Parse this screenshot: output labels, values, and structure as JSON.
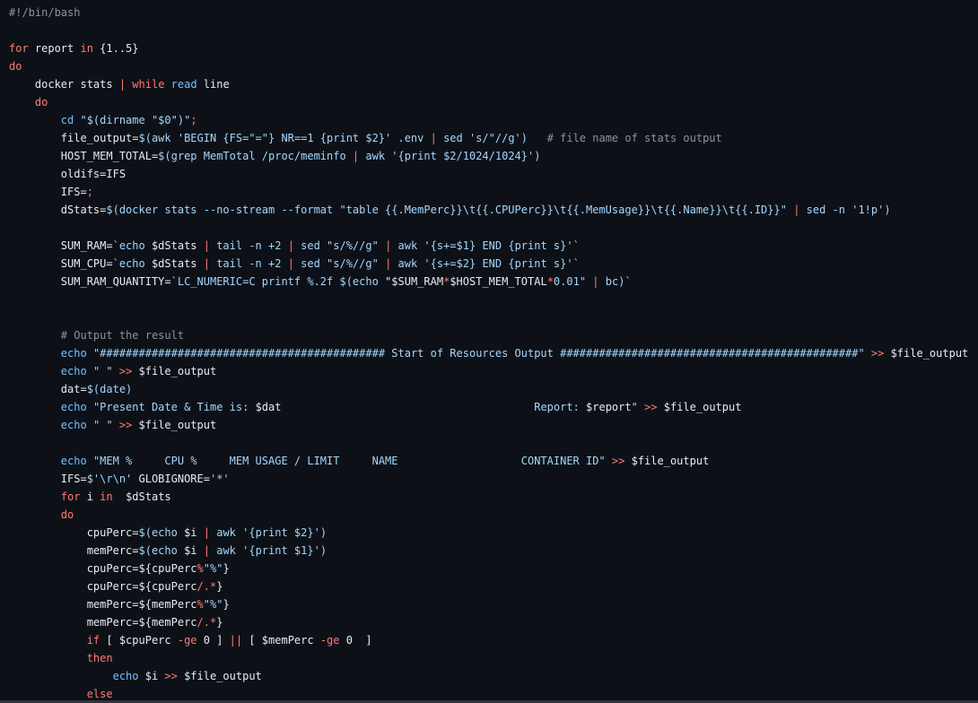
{
  "colors": {
    "background": "#0d1117",
    "default": "#e6edf3",
    "keyword": "#ff7b72",
    "builtin": "#79c0ff",
    "string": "#a5d6ff",
    "comment": "#8b949e"
  },
  "code": {
    "lines": [
      [
        [
          "shebang",
          "#!/bin/bash"
        ]
      ],
      [],
      [
        [
          "keyword",
          "for"
        ],
        [
          "default",
          " report "
        ],
        [
          "keyword",
          "in"
        ],
        [
          "default",
          " {1..5}"
        ]
      ],
      [
        [
          "keyword",
          "do"
        ]
      ],
      [
        [
          "default",
          "    docker stats "
        ],
        [
          "op",
          "|"
        ],
        [
          "default",
          " "
        ],
        [
          "keyword",
          "while"
        ],
        [
          "default",
          " "
        ],
        [
          "builtin",
          "read"
        ],
        [
          "default",
          " line"
        ]
      ],
      [
        [
          "default",
          "    "
        ],
        [
          "keyword",
          "do"
        ]
      ],
      [
        [
          "default",
          "        "
        ],
        [
          "builtin",
          "cd"
        ],
        [
          "default",
          " "
        ],
        [
          "string",
          "\"$(dirname \"$0\")\""
        ],
        [
          "op",
          ";"
        ]
      ],
      [
        [
          "default",
          "        file_output="
        ],
        [
          "string",
          "$(awk 'BEGIN {FS=\"=\"} NR==1 {print $2}' .env "
        ],
        [
          "op",
          "|"
        ],
        [
          "string",
          " sed 's/\"//g')"
        ],
        [
          "default",
          "   "
        ],
        [
          "comment",
          "# file name of stats output"
        ]
      ],
      [
        [
          "default",
          "        HOST_MEM_TOTAL="
        ],
        [
          "string",
          "$(grep MemTotal /proc/meminfo "
        ],
        [
          "op",
          "|"
        ],
        [
          "string",
          " awk '{print $2/1024/1024}')"
        ]
      ],
      [
        [
          "default",
          "        oldifs=IFS"
        ]
      ],
      [
        [
          "default",
          "        IFS="
        ],
        [
          "op",
          ";"
        ]
      ],
      [
        [
          "default",
          "        dStats="
        ],
        [
          "string",
          "$(docker stats --no-stream --format \"table {{.MemPerc}}\\t{{.CPUPerc}}\\t{{.MemUsage}}\\t{{.Name}}\\t{{.ID}}\" "
        ],
        [
          "op",
          "|"
        ],
        [
          "string",
          " sed -n '1!p')"
        ]
      ],
      [],
      [
        [
          "default",
          "        SUM_RAM="
        ],
        [
          "string",
          "`echo "
        ],
        [
          "default",
          "$dStats "
        ],
        [
          "op",
          "|"
        ],
        [
          "string",
          " tail -n +2 "
        ],
        [
          "op",
          "|"
        ],
        [
          "string",
          " sed \"s/%//g\" "
        ],
        [
          "op",
          "|"
        ],
        [
          "string",
          " awk '{s+=$1} END {print s}'`"
        ]
      ],
      [
        [
          "default",
          "        SUM_CPU="
        ],
        [
          "string",
          "`echo "
        ],
        [
          "default",
          "$dStats "
        ],
        [
          "op",
          "|"
        ],
        [
          "string",
          " tail -n +2 "
        ],
        [
          "op",
          "|"
        ],
        [
          "string",
          " sed \"s/%//g\" "
        ],
        [
          "op",
          "|"
        ],
        [
          "string",
          " awk '{s+=$2} END {print s}'`"
        ]
      ],
      [
        [
          "default",
          "        SUM_RAM_QUANTITY="
        ],
        [
          "string",
          "`LC_NUMERIC=C printf %.2f $(echo "
        ],
        [
          "default",
          "\"$SUM_RAM"
        ],
        [
          "op",
          "*"
        ],
        [
          "default",
          "$HOST_MEM_TOTAL"
        ],
        [
          "op",
          "*"
        ],
        [
          "string",
          "0.01\" "
        ],
        [
          "op",
          "|"
        ],
        [
          "string",
          " bc)`"
        ]
      ],
      [],
      [],
      [
        [
          "default",
          "        "
        ],
        [
          "comment",
          "# Output the result"
        ]
      ],
      [
        [
          "default",
          "        "
        ],
        [
          "builtin",
          "echo"
        ],
        [
          "default",
          " "
        ],
        [
          "string",
          "\"############################################ Start of Resources Output ##############################################\""
        ],
        [
          "default",
          " "
        ],
        [
          "op",
          ">>"
        ],
        [
          "default",
          " $file_output"
        ]
      ],
      [
        [
          "default",
          "        "
        ],
        [
          "builtin",
          "echo"
        ],
        [
          "default",
          " "
        ],
        [
          "string",
          "\" \""
        ],
        [
          "default",
          " "
        ],
        [
          "op",
          ">>"
        ],
        [
          "default",
          " $file_output"
        ]
      ],
      [
        [
          "default",
          "        dat="
        ],
        [
          "string",
          "$(date)"
        ]
      ],
      [
        [
          "default",
          "        "
        ],
        [
          "builtin",
          "echo"
        ],
        [
          "default",
          " "
        ],
        [
          "string",
          "\"Present Date & Time is: "
        ],
        [
          "default",
          "$dat"
        ],
        [
          "string",
          "                                       Report: "
        ],
        [
          "default",
          "$report"
        ],
        [
          "string",
          "\""
        ],
        [
          "default",
          " "
        ],
        [
          "op",
          ">>"
        ],
        [
          "default",
          " $file_output"
        ]
      ],
      [
        [
          "default",
          "        "
        ],
        [
          "builtin",
          "echo"
        ],
        [
          "default",
          " "
        ],
        [
          "string",
          "\" \""
        ],
        [
          "default",
          " "
        ],
        [
          "op",
          ">>"
        ],
        [
          "default",
          " $file_output"
        ]
      ],
      [],
      [
        [
          "default",
          "        "
        ],
        [
          "builtin",
          "echo"
        ],
        [
          "default",
          " "
        ],
        [
          "string",
          "\"MEM %     CPU %     MEM USAGE / LIMIT     NAME                   CONTAINER ID\""
        ],
        [
          "default",
          " "
        ],
        [
          "op",
          ">>"
        ],
        [
          "default",
          " $file_output"
        ]
      ],
      [
        [
          "default",
          "        IFS="
        ],
        [
          "string",
          "$'\\r\\n'"
        ],
        [
          "default",
          " GLOBIGNORE="
        ],
        [
          "string",
          "'*'"
        ]
      ],
      [
        [
          "default",
          "        "
        ],
        [
          "keyword",
          "for"
        ],
        [
          "default",
          " i "
        ],
        [
          "keyword",
          "in"
        ],
        [
          "default",
          "  $dStats"
        ]
      ],
      [
        [
          "default",
          "        "
        ],
        [
          "keyword",
          "do"
        ]
      ],
      [
        [
          "default",
          "            cpuPerc="
        ],
        [
          "string",
          "$(echo "
        ],
        [
          "default",
          "$i "
        ],
        [
          "op",
          "|"
        ],
        [
          "string",
          " awk '{print $2}')"
        ]
      ],
      [
        [
          "default",
          "            memPerc="
        ],
        [
          "string",
          "$(echo "
        ],
        [
          "default",
          "$i "
        ],
        [
          "op",
          "|"
        ],
        [
          "string",
          " awk '{print $1}')"
        ]
      ],
      [
        [
          "default",
          "            cpuPerc=${cpuPerc"
        ],
        [
          "op",
          "%"
        ],
        [
          "string",
          "\"%\""
        ],
        [
          "default",
          "}"
        ]
      ],
      [
        [
          "default",
          "            cpuPerc=${cpuPerc"
        ],
        [
          "op",
          "/.*"
        ],
        [
          "default",
          "}"
        ]
      ],
      [
        [
          "default",
          "            memPerc=${memPerc"
        ],
        [
          "op",
          "%"
        ],
        [
          "string",
          "\"%\""
        ],
        [
          "default",
          "}"
        ]
      ],
      [
        [
          "default",
          "            memPerc=${memPerc"
        ],
        [
          "op",
          "/.*"
        ],
        [
          "default",
          "}"
        ]
      ],
      [
        [
          "default",
          "            "
        ],
        [
          "keyword",
          "if"
        ],
        [
          "default",
          " [ $cpuPerc "
        ],
        [
          "op",
          "-ge"
        ],
        [
          "default",
          " 0 ] "
        ],
        [
          "op",
          "||"
        ],
        [
          "default",
          " [ $memPerc "
        ],
        [
          "op",
          "-ge"
        ],
        [
          "default",
          " 0  ]"
        ]
      ],
      [
        [
          "default",
          "            "
        ],
        [
          "keyword",
          "then"
        ]
      ],
      [
        [
          "default",
          "                "
        ],
        [
          "builtin",
          "echo"
        ],
        [
          "default",
          " $i "
        ],
        [
          "op",
          ">>"
        ],
        [
          "default",
          " $file_output"
        ]
      ],
      [
        [
          "default",
          "            "
        ],
        [
          "keyword",
          "else"
        ]
      ]
    ]
  }
}
